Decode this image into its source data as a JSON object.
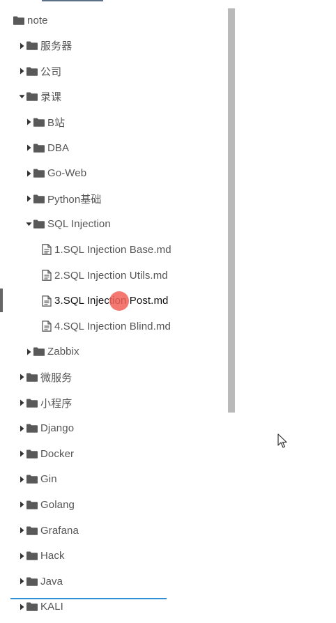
{
  "tree": [
    {
      "label": "note",
      "depth": 0,
      "type": "folder",
      "expanded": true,
      "arrow": false
    },
    {
      "label": "服务器",
      "depth": 1,
      "type": "folder",
      "expanded": false
    },
    {
      "label": "公司",
      "depth": 1,
      "type": "folder",
      "expanded": false
    },
    {
      "label": "录课",
      "depth": 1,
      "type": "folder",
      "expanded": true
    },
    {
      "label": "B站",
      "depth": 2,
      "type": "folder",
      "expanded": false
    },
    {
      "label": "DBA",
      "depth": 2,
      "type": "folder",
      "expanded": false
    },
    {
      "label": "Go-Web",
      "depth": 2,
      "type": "folder",
      "expanded": false
    },
    {
      "label": "Python基础",
      "depth": 2,
      "type": "folder",
      "expanded": false
    },
    {
      "label": "SQL Injection",
      "depth": 2,
      "type": "folder",
      "expanded": true
    },
    {
      "label": "1.SQL Injection Base.md",
      "depth": 3,
      "type": "file"
    },
    {
      "label": "2.SQL Injection Utils.md",
      "depth": 3,
      "type": "file"
    },
    {
      "label": "3.SQL Injection Post.md",
      "depth": 3,
      "type": "file",
      "active": true
    },
    {
      "label": "4.SQL Injection Blind.md",
      "depth": 3,
      "type": "file"
    },
    {
      "label": "Zabbix",
      "depth": 2,
      "type": "folder",
      "expanded": false
    },
    {
      "label": "微服务",
      "depth": 1,
      "type": "folder",
      "expanded": false
    },
    {
      "label": "小程序",
      "depth": 1,
      "type": "folder",
      "expanded": false
    },
    {
      "label": "Django",
      "depth": 1,
      "type": "folder",
      "expanded": false
    },
    {
      "label": "Docker",
      "depth": 1,
      "type": "folder",
      "expanded": false
    },
    {
      "label": "Gin",
      "depth": 1,
      "type": "folder",
      "expanded": false
    },
    {
      "label": "Golang",
      "depth": 1,
      "type": "folder",
      "expanded": false
    },
    {
      "label": "Grafana",
      "depth": 1,
      "type": "folder",
      "expanded": false
    },
    {
      "label": "Hack",
      "depth": 1,
      "type": "folder",
      "expanded": false
    },
    {
      "label": "Java",
      "depth": 1,
      "type": "folder",
      "expanded": false
    },
    {
      "label": "KALI",
      "depth": 1,
      "type": "folder",
      "expanded": false
    }
  ],
  "icons": {
    "folder": "folder-icon",
    "file": "file-icon",
    "collapsed": "caret-right-icon",
    "expanded": "caret-down-icon"
  },
  "colors": {
    "text": "#555555",
    "active_text": "#111111",
    "icon": "#595959",
    "scrollbar": "#b9b9b9",
    "click_indicator": "#f16058",
    "accent_line": "#2e8fd8"
  }
}
